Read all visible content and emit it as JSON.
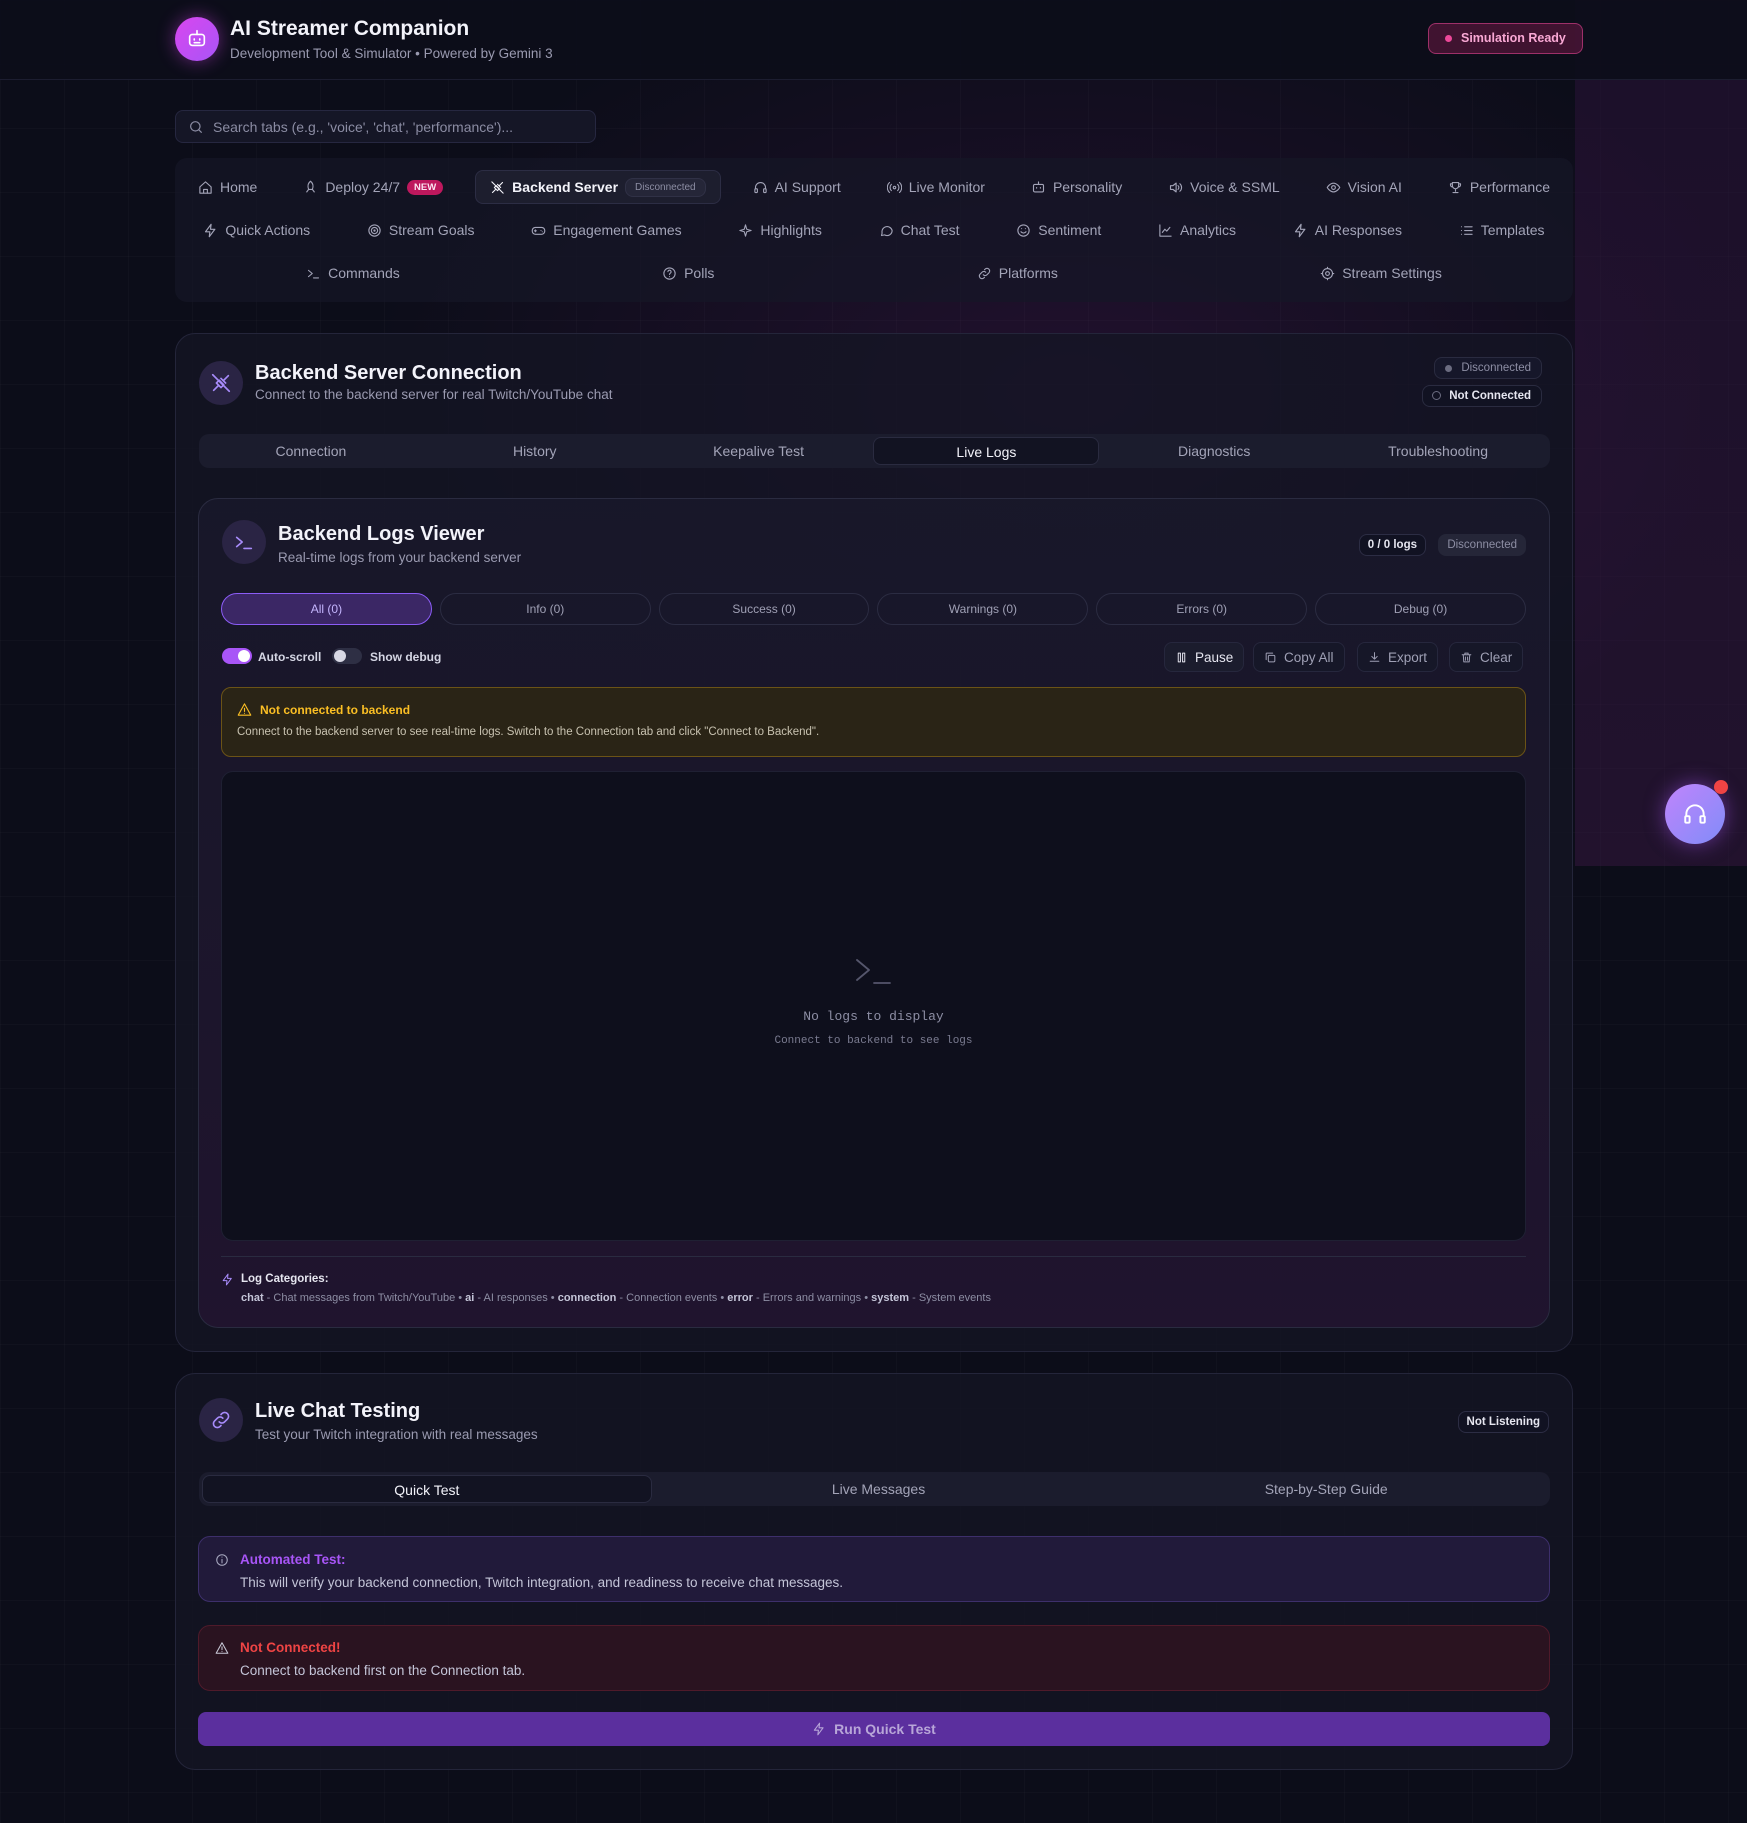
{
  "header": {
    "title": "AI Streamer Companion",
    "subtitle": "Development Tool & Simulator • Powered by Gemini 3",
    "status_badge": "Simulation Ready"
  },
  "search": {
    "placeholder": "Search tabs (e.g., 'voice', 'chat', 'performance')...",
    "value": ""
  },
  "nav": {
    "row1": [
      {
        "label": "Home",
        "icon": "home-icon"
      },
      {
        "label": "Deploy 24/7",
        "icon": "rocket-icon",
        "badge": "NEW"
      },
      {
        "label": "Backend Server",
        "icon": "plug-icon",
        "badge": "Disconnected",
        "active": true
      },
      {
        "label": "AI Support",
        "icon": "headset-icon"
      },
      {
        "label": "Live Monitor",
        "icon": "broadcast-icon"
      },
      {
        "label": "Personality",
        "icon": "bot-icon"
      },
      {
        "label": "Voice & SSML",
        "icon": "speaker-icon"
      },
      {
        "label": "Vision AI",
        "icon": "eye-icon"
      },
      {
        "label": "Performance",
        "icon": "trophy-icon"
      }
    ],
    "row2": [
      {
        "label": "Quick Actions",
        "icon": "bolt-icon"
      },
      {
        "label": "Stream Goals",
        "icon": "target-icon"
      },
      {
        "label": "Engagement Games",
        "icon": "gamepad-icon"
      },
      {
        "label": "Highlights",
        "icon": "sparkle-icon"
      },
      {
        "label": "Chat Test",
        "icon": "chat-bubble-icon"
      },
      {
        "label": "Sentiment",
        "icon": "smile-icon"
      },
      {
        "label": "Analytics",
        "icon": "line-chart-icon"
      },
      {
        "label": "AI Responses",
        "icon": "bolt-icon"
      },
      {
        "label": "Templates",
        "icon": "list-icon"
      }
    ],
    "row3": [
      {
        "label": "Commands",
        "icon": "terminal-icon"
      },
      {
        "label": "Polls",
        "icon": "help-circle-icon"
      },
      {
        "label": "Platforms",
        "icon": "link-icon"
      },
      {
        "label": "Stream Settings",
        "icon": "gear-icon"
      }
    ]
  },
  "backend_card": {
    "title": "Backend Server Connection",
    "subtitle": "Connect to the backend server for real Twitch/YouTube chat",
    "status_disconnected": "Disconnected",
    "status_not_connected": "Not Connected",
    "tabs": [
      "Connection",
      "History",
      "Keepalive Test",
      "Live Logs",
      "Diagnostics",
      "Troubleshooting"
    ],
    "active_tab": "Live Logs"
  },
  "logs": {
    "title": "Backend Logs Viewer",
    "subtitle": "Real-time logs from your backend server",
    "count": "0 / 0 logs",
    "status": "Disconnected",
    "filters": [
      "All (0)",
      "Info (0)",
      "Success (0)",
      "Warnings (0)",
      "Errors (0)",
      "Debug (0)"
    ],
    "autoscroll_label": "Auto-scroll",
    "autoscroll_on": true,
    "debug_label": "Show debug",
    "debug_on": false,
    "buttons": {
      "pause": "Pause",
      "copy": "Copy All",
      "export": "Export",
      "clear": "Clear"
    },
    "warning_title": "Not connected to backend",
    "warning_text": "Connect to the backend server to see real-time logs. Switch to the Connection tab and click \"Connect to Backend\".",
    "empty_title": "No logs to display",
    "empty_sub": "Connect to backend to see logs",
    "categories_title": "Log Categories:",
    "categories": [
      {
        "key": "chat",
        "desc": "Chat messages from Twitch/YouTube"
      },
      {
        "key": "ai",
        "desc": "AI responses"
      },
      {
        "key": "connection",
        "desc": "Connection events"
      },
      {
        "key": "error",
        "desc": "Errors and warnings"
      },
      {
        "key": "system",
        "desc": "System events"
      }
    ]
  },
  "chat_card": {
    "title": "Live Chat Testing",
    "subtitle": "Test your Twitch integration with real messages",
    "status": "Not Listening",
    "tabs": [
      "Quick Test",
      "Live Messages",
      "Step-by-Step Guide"
    ],
    "active_tab": "Quick Test",
    "info_title": "Automated Test:",
    "info_text": "This will verify your backend connection, Twitch integration, and readiness to receive chat messages.",
    "error_title": "Not Connected!",
    "error_text": "Connect to backend first on the Connection tab.",
    "run_label": "Run Quick Test"
  },
  "colors": {
    "accent": "#a855f7",
    "pink": "#ec4899",
    "warning": "#f59e0b",
    "error": "#ef4444",
    "background": "#0c0d19"
  }
}
